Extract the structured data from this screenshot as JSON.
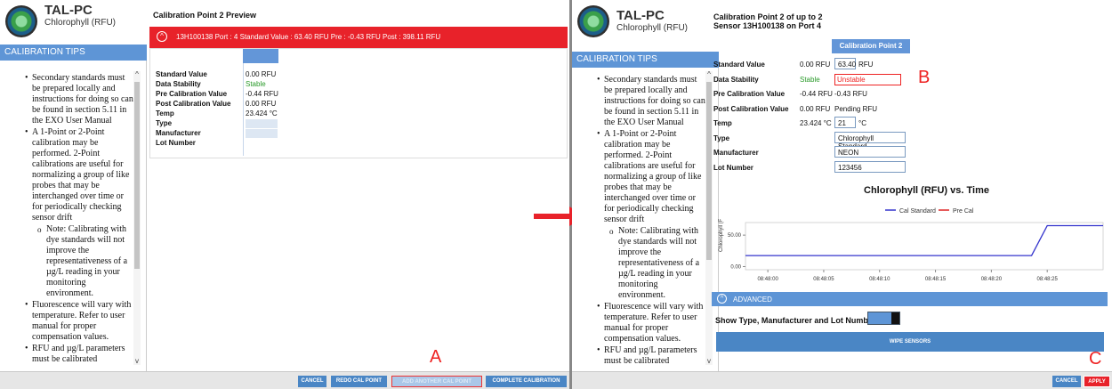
{
  "left": {
    "app_title": "TAL-PC",
    "app_subtitle": "Chlorophyll (RFU)",
    "tips_header": "CALIBRATION TIPS",
    "tips": [
      {
        "kind": "b",
        "text": "Secondary standards must be prepared locally and instructions for doing so can be found in section 5.11 in the EXO User Manual"
      },
      {
        "kind": "b",
        "text": "A 1-Point or 2-Point calibration may be performed. 2-Point calibrations are useful for normalizing a group of like probes that may be interchanged over time or for periodically checking sensor drift"
      },
      {
        "kind": "s",
        "text": "Note: Calibrating with dye standards will not improve the representativeness of a µg/L reading in your monitoring environment."
      },
      {
        "kind": "b",
        "text": "Fluorescence will vary with temperature. Refer to user manual for proper compensation values."
      },
      {
        "kind": "b",
        "text": "RFU and µg/L parameters must be calibrated"
      }
    ],
    "content_title": "Calibration Point 2 Preview",
    "banner": "13H100138 Port : 4   Standard Value : 63.40 RFU   Pre : -0.43 RFU   Post : 398.11 RFU",
    "banner_icon": "chevron-up-circle-icon",
    "rows": [
      {
        "label": "Standard Value",
        "value": "0.00 RFU"
      },
      {
        "label": "Data Stability",
        "value": "Stable"
      },
      {
        "label": "Pre Calibration Value",
        "value": "-0.44 RFU"
      },
      {
        "label": "Post Calibration Value",
        "value": "0.00 RFU"
      },
      {
        "label": "Temp",
        "value": "23.424 °C"
      },
      {
        "label": "Type",
        "value": ""
      },
      {
        "label": "Manufacturer",
        "value": ""
      },
      {
        "label": "Lot Number",
        "value": ""
      }
    ],
    "buttons": {
      "cancel": "CANCEL",
      "redo": "REDO CAL POINT",
      "add": "ADD ANOTHER CAL POINT",
      "complete": "COMPLETE CALIBRATION"
    },
    "callout_a": "A"
  },
  "right": {
    "app_title": "TAL-PC",
    "app_subtitle": "Chlorophyll (RFU)",
    "tips_header": "CALIBRATION TIPS",
    "title_line1": "Calibration Point 2 of up to 2",
    "title_line2": "Sensor 13H100138 on Port 4",
    "cal_point_header": "Calibration Point 2",
    "rows": [
      {
        "label": "Standard Value",
        "current": "0.00 RFU",
        "new": "63.40",
        "unit": "RFU"
      },
      {
        "label": "Data Stability",
        "current": "Stable",
        "new": "Unstable"
      },
      {
        "label": "Pre Calibration Value",
        "current": "-0.44 RFU",
        "new": "-0.43 RFU"
      },
      {
        "label": "Post Calibration Value",
        "current": "0.00 RFU",
        "new": "Pending RFU"
      },
      {
        "label": "Temp",
        "current": "23.424 °C",
        "new": "21",
        "unit": "°C"
      },
      {
        "label": "Type",
        "current": "",
        "new": "Chlorophyll Standard"
      },
      {
        "label": "Manufacturer",
        "current": "",
        "new": "NEON"
      },
      {
        "label": "Lot Number",
        "current": "",
        "new": "123456"
      }
    ],
    "callout_b": "B",
    "advanced_label": "ADVANCED",
    "show_type_label": "Show Type, Manufacturer and Lot Number",
    "wipe_label": "WIPE SENSORS",
    "buttons": {
      "cancel": "CANCEL",
      "apply": "APPLY"
    },
    "callout_c": "C"
  },
  "chart_data": {
    "type": "line",
    "title": "Chlorophyll (RFU) vs. Time",
    "ylabel": "Chlorophyll (F",
    "x_ticks": [
      "08:48:00",
      "08:48:05",
      "08:48:10",
      "08:48:15",
      "08:48:20",
      "08:48:25"
    ],
    "y_ticks": [
      0.0,
      50.0
    ],
    "y_tick_labels": [
      "0.00",
      "50.00"
    ],
    "ylim": [
      -5,
      70
    ],
    "xlim": [
      -2,
      30
    ],
    "legend_position": "top-center",
    "series": [
      {
        "name": "Cal Standard",
        "color": "#3333cc",
        "x": [
          -2,
          23.6,
          25,
          30
        ],
        "y": [
          17.5,
          17.5,
          65,
          65
        ]
      },
      {
        "name": "Pre Cal",
        "color": "#dd2222",
        "x": [],
        "y": []
      }
    ]
  },
  "colors": {
    "accent": "#5e95d6",
    "button": "#4a86c5",
    "alert": "#e8222a"
  }
}
